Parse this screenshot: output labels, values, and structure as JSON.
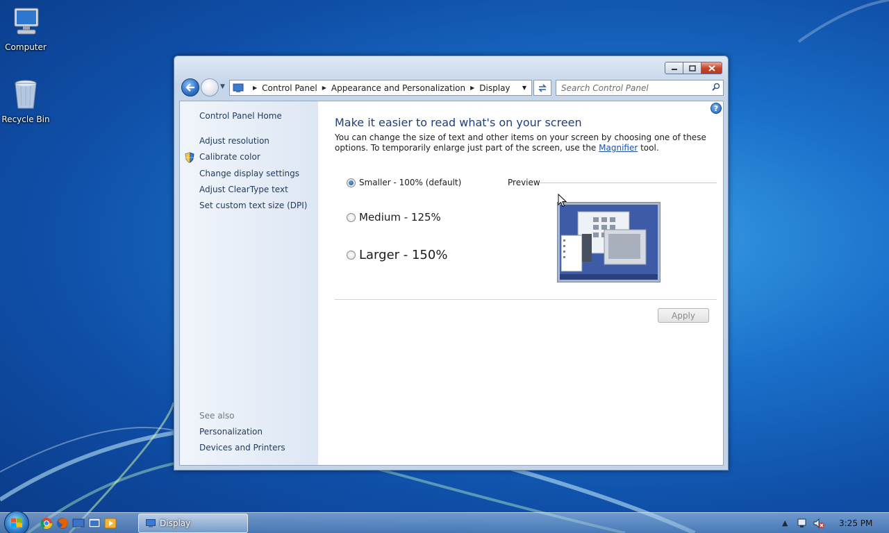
{
  "desktop": {
    "icons": [
      {
        "label": "Computer",
        "icon": "computer-icon"
      },
      {
        "label": "Recycle Bin",
        "icon": "recycle-bin-icon"
      }
    ]
  },
  "window": {
    "caption_buttons": {
      "minimize": "minimize",
      "maximize": "maximize",
      "close": "close"
    },
    "address": {
      "icon": "control-panel-icon",
      "crumbs": [
        "Control Panel",
        "Appearance and Personalization",
        "Display"
      ]
    },
    "search": {
      "placeholder": "Search Control Panel"
    },
    "left_pane": {
      "home": "Control Panel Home",
      "tasks": [
        "Adjust resolution",
        "Calibrate color",
        "Change display settings",
        "Adjust ClearType text",
        "Set custom text size (DPI)"
      ],
      "see_also_label": "See also",
      "see_also": [
        "Personalization",
        "Devices and Printers"
      ]
    },
    "main": {
      "heading": "Make it easier to read what's on your screen",
      "desc_before": "You can change the size of text and other items on your screen by choosing one of these options. To temporarily enlarge just part of the screen, use the ",
      "desc_link": "Magnifier",
      "desc_after": " tool.",
      "options": [
        {
          "label": "Smaller - 100% (default)",
          "checked": true
        },
        {
          "label": "Medium - 125%",
          "checked": false
        },
        {
          "label": "Larger - 150%",
          "checked": false
        }
      ],
      "preview_label": "Preview",
      "apply_label": "Apply"
    }
  },
  "taskbar": {
    "pinned": [
      "chrome-icon",
      "firefox-icon",
      "explorer-icon",
      "network-icon",
      "media-player-icon"
    ],
    "task_label": "Display",
    "clock": "3:25 PM",
    "colors": {
      "accent": "#1a6fc9"
    }
  }
}
